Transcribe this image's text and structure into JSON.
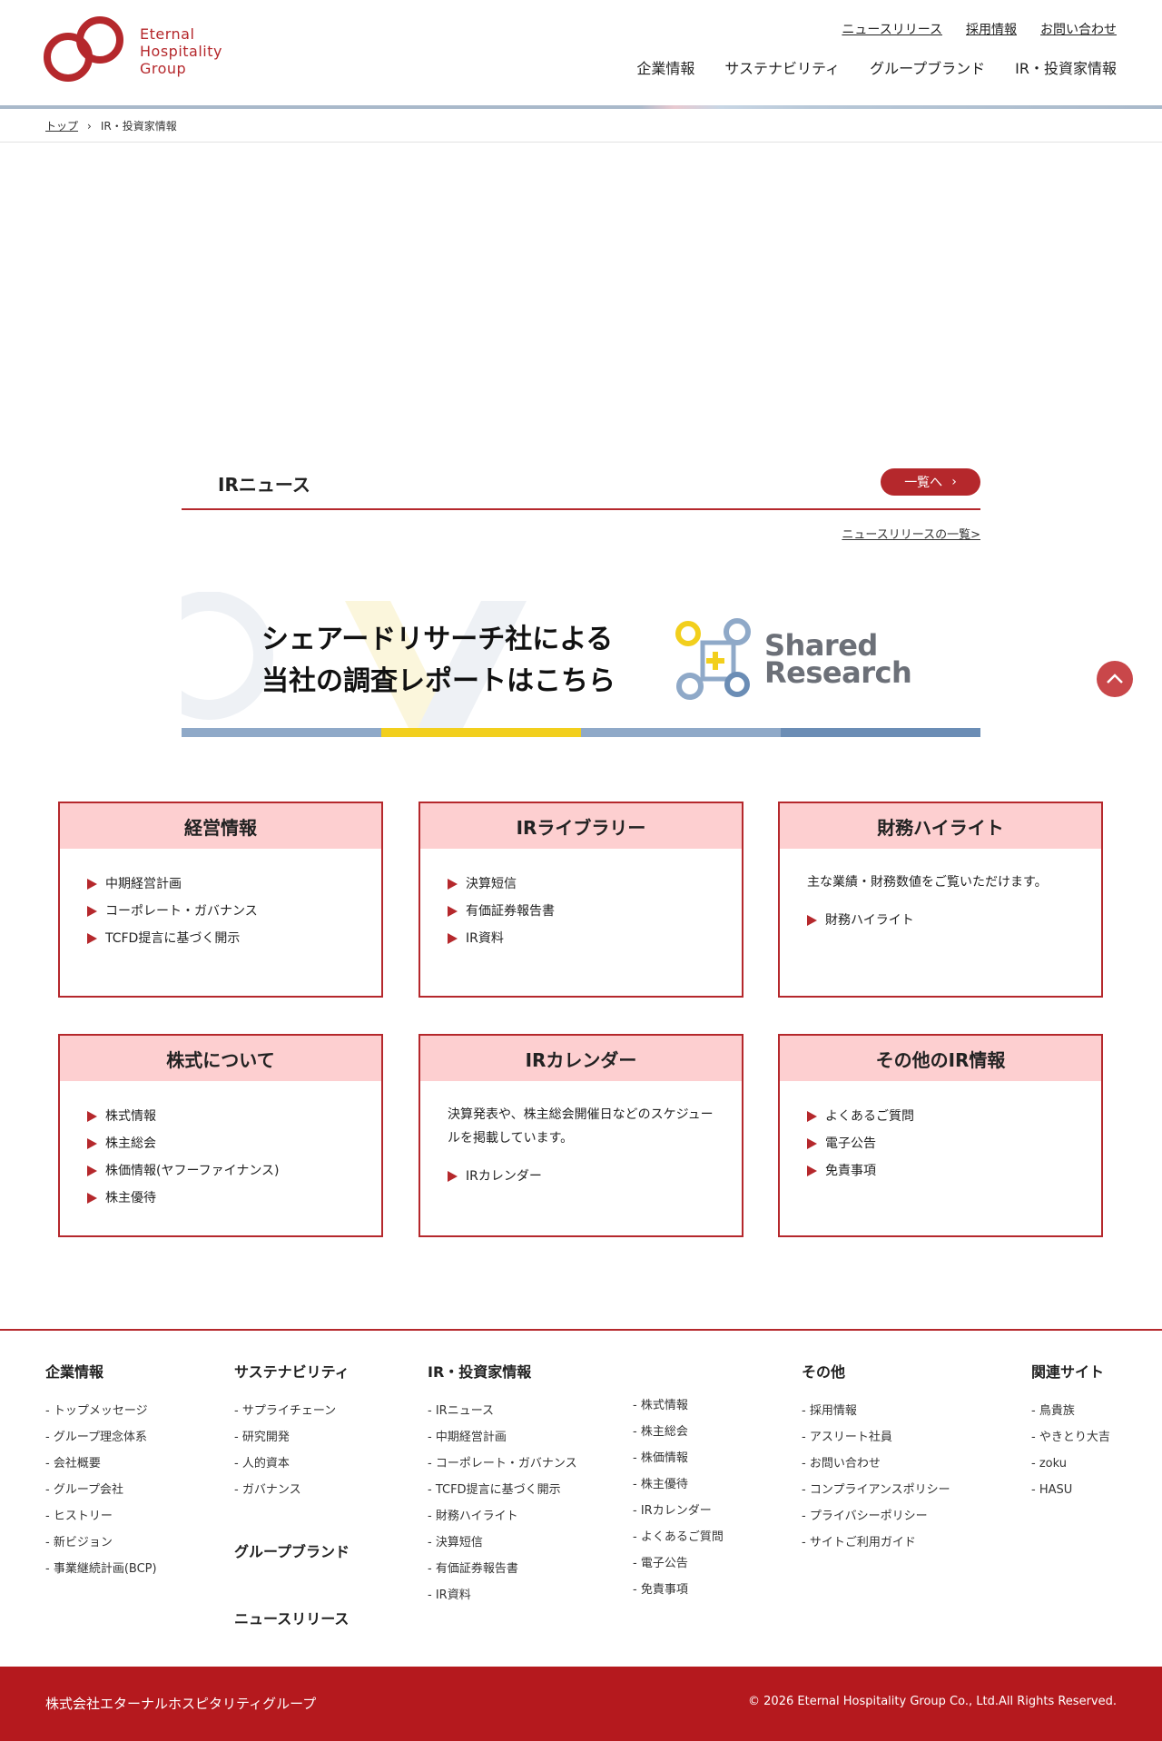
{
  "header": {
    "logo_lines": [
      "Eternal",
      "Hospitality",
      "Group"
    ],
    "util_nav": [
      "ニュースリリース",
      "採用情報",
      "お問い合わせ"
    ],
    "main_nav": [
      "企業情報",
      "サステナビリティ",
      "グループブランド",
      "IR・投資家情報"
    ]
  },
  "breadcrumb": {
    "home": "トップ",
    "current": "IR・投資家情報"
  },
  "ir_news": {
    "title": "IRニュース",
    "more_label": "一覧へ",
    "list_link": "ニュースリリースの一覧>"
  },
  "banner": {
    "line1": "シェアードリサーチ社による",
    "line2": "当社の調査レポートはこちら",
    "logo_line1": "Shared",
    "logo_line2": "Research",
    "stripe_colors": [
      "#8fa9c8",
      "#f2cf1d",
      "#8fa9c8",
      "#6b8db5"
    ]
  },
  "cards": [
    {
      "title": "経営情報",
      "desc": "",
      "items": [
        "中期経営計画",
        "コーポレート・ガバナンス",
        "TCFD提言に基づく開示"
      ]
    },
    {
      "title": "IRライブラリー",
      "desc": "",
      "items": [
        "決算短信",
        "有価証券報告書",
        "IR資料"
      ]
    },
    {
      "title": "財務ハイライト",
      "desc": "主な業績・財務数値をご覧いただけます。",
      "items": [
        "財務ハイライト"
      ]
    },
    {
      "title": "株式について",
      "desc": "",
      "items": [
        "株式情報",
        "株主総会",
        "株価情報(ヤフーファイナンス)",
        "株主優待"
      ]
    },
    {
      "title": "IRカレンダー",
      "desc": "決算発表や、株主総会開催日などのスケジュールを掲載しています。",
      "items": [
        "IRカレンダー"
      ]
    },
    {
      "title": "その他のIR情報",
      "desc": "",
      "items": [
        "よくあるご質問",
        "電子公告",
        "免責事項"
      ]
    }
  ],
  "footer": {
    "company": {
      "title": "企業情報",
      "items": [
        "トップメッセージ",
        "グループ理念体系",
        "会社概要",
        "グループ会社",
        "ヒストリー",
        "新ビジョン",
        "事業継続計画(BCP)"
      ]
    },
    "sustainability": {
      "title": "サステナビリティ",
      "items": [
        "サプライチェーン",
        "研究開発",
        "人的資本",
        "ガバナンス"
      ]
    },
    "brand": "グループブランド",
    "news": "ニュースリリース",
    "ir": {
      "title": "IR・投資家情報",
      "items_left": [
        "IRニュース",
        "中期経営計画",
        "コーポレート・ガバナンス",
        "TCFD提言に基づく開示",
        "財務ハイライト",
        "決算短信",
        "有価証券報告書",
        "IR資料"
      ],
      "items_right": [
        "株式情報",
        "株主総会",
        "株価情報",
        "株主優待",
        "IRカレンダー",
        "よくあるご質問",
        "電子公告",
        "免責事項"
      ]
    },
    "other": {
      "title": "その他",
      "items": [
        "採用情報",
        "アスリート社員",
        "お問い合わせ",
        "コンプライアンスポリシー",
        "プライバシーポリシー",
        "サイトご利用ガイド"
      ]
    },
    "related": {
      "title": "関連サイト",
      "items": [
        "鳥貴族",
        "やきとり大吉",
        "zoku",
        "HASU"
      ]
    },
    "company_name": "株式会社エターナルホスピタリティグループ",
    "copyright": "© 2026 Eternal Hospitality Group Co., Ltd.All Rights Reserved."
  },
  "colors": {
    "brand_red": "#b5282c",
    "card_head_pink": "#fdcfd0",
    "footer_red": "#b5191e"
  }
}
